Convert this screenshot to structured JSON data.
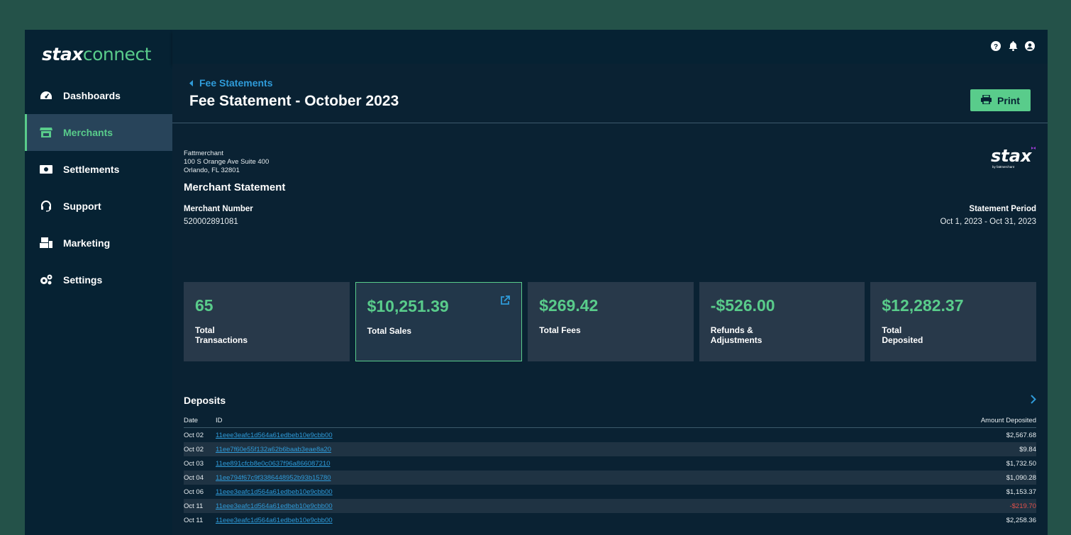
{
  "brand": {
    "stax": "stax",
    "connect": "connect"
  },
  "sidebar": {
    "items": [
      {
        "label": "Dashboards",
        "icon": "dashboard-icon"
      },
      {
        "label": "Merchants",
        "icon": "store-icon",
        "active": true
      },
      {
        "label": "Settlements",
        "icon": "money-icon"
      },
      {
        "label": "Support",
        "icon": "headset-icon"
      },
      {
        "label": "Marketing",
        "icon": "marketing-icon"
      },
      {
        "label": "Settings",
        "icon": "gears-icon"
      }
    ]
  },
  "topbar": {
    "icons": [
      "help-icon",
      "bell-icon",
      "user-icon"
    ]
  },
  "header": {
    "back_label": "Fee Statements",
    "title": "Fee Statement - October 2023",
    "print_label": "Print"
  },
  "statement": {
    "company": "Fattmerchant",
    "address1": "100 S Orange Ave Suite 400",
    "address2": "Orlando, FL 32801",
    "title": "Merchant Statement",
    "merchant_number_label": "Merchant Number",
    "merchant_number": "520002891081",
    "period_label": "Statement Period",
    "period": "Oct 1, 2023 - Oct 31, 2023",
    "logo_text": "stax",
    "logo_sub": "by fattmerchant"
  },
  "cards": [
    {
      "value": "65",
      "label": "Total Transactions"
    },
    {
      "value": "$10,251.39",
      "label": "Total Sales"
    },
    {
      "value": "$269.42",
      "label": "Total Fees"
    },
    {
      "value": "-$526.00",
      "label": "Refunds & Adjustments"
    },
    {
      "value": "$12,282.37",
      "label": "Total Deposited"
    }
  ],
  "deposits": {
    "title": "Deposits",
    "headers": {
      "date": "Date",
      "id": "ID",
      "amount": "Amount Deposited"
    },
    "rows": [
      {
        "date": "Oct 02",
        "id": "11eee3eafc1d564a61edbeb10e9cbb00",
        "amount": "$2,567.68"
      },
      {
        "date": "Oct 02",
        "id": "11ee7f60e55f132a62b6baab3eae8a20",
        "amount": "$9.84"
      },
      {
        "date": "Oct 03",
        "id": "11ee891cfcb8e0c0637f96a866087210",
        "amount": "$1,732.50"
      },
      {
        "date": "Oct 04",
        "id": "11ee794f67c9f3386448952b93b15780",
        "amount": "$1,090.28"
      },
      {
        "date": "Oct 06",
        "id": "11eee3eafc1d564a61edbeb10e9cbb00",
        "amount": "$1,153.37"
      },
      {
        "date": "Oct 11",
        "id": "11eee3eafc1d564a61edbeb10e9cbb00",
        "amount": "-$219.70"
      },
      {
        "date": "Oct 11",
        "id": "11eee3eafc1d564a61edbeb10e9cbb00",
        "amount": "$2,258.36"
      }
    ]
  },
  "colors": {
    "accent": "#59cc8b",
    "link": "#2f9bd9",
    "negative": "#e2504b",
    "background": "#062233"
  }
}
